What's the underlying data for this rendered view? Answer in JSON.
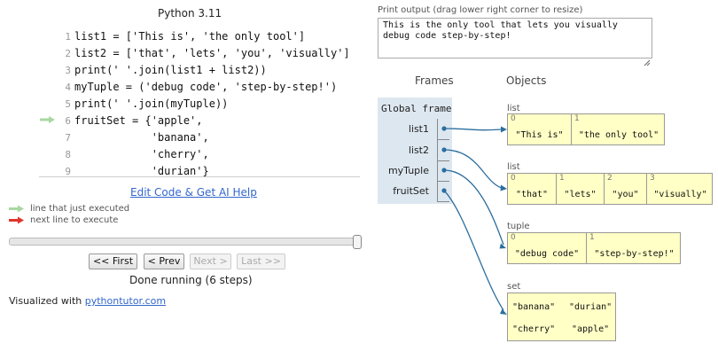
{
  "header": {
    "language": "Python 3.11"
  },
  "code": {
    "lines": [
      {
        "num": "1",
        "text": "list1 = ['This is', 'the only tool']"
      },
      {
        "num": "2",
        "text": "list2 = ['that', 'lets', 'you', 'visually']"
      },
      {
        "num": "3",
        "text": "print(' '.join(list1 + list2))"
      },
      {
        "num": "4",
        "text": "myTuple = ('debug code', 'step-by-step!')"
      },
      {
        "num": "5",
        "text": "print(' '.join(myTuple))"
      },
      {
        "num": "6",
        "text": "fruitSet = {'apple',"
      },
      {
        "num": "7",
        "text": "            'banana',"
      },
      {
        "num": "8",
        "text": "            'cherry',"
      },
      {
        "num": "9",
        "text": "            'durian'}"
      }
    ],
    "current_line": 6
  },
  "links": {
    "edit": "Edit Code & Get AI Help"
  },
  "legend": {
    "executed": "line that just executed",
    "next": "next line to execute",
    "executed_color": "#a8d8a0",
    "next_color": "#e0352b"
  },
  "nav": {
    "first": "<< First",
    "prev": "< Prev",
    "next": "Next >",
    "last": "Last >>",
    "status": "Done running (6 steps)"
  },
  "footer": {
    "prefix": "Visualized with ",
    "link": "pythontutor.com"
  },
  "output": {
    "label": "Print output (drag lower right corner to resize)",
    "text": "This is the only tool that lets you visually\ndebug code step-by-step!"
  },
  "viz": {
    "frames_header": "Frames",
    "objects_header": "Objects",
    "frame_title": "Global frame",
    "variables": [
      "list1",
      "list2",
      "myTuple",
      "fruitSet"
    ],
    "objects": [
      {
        "type": "list",
        "items": [
          {
            "index": "0",
            "value": "\"This is\""
          },
          {
            "index": "1",
            "value": "\"the only tool\""
          }
        ]
      },
      {
        "type": "list",
        "items": [
          {
            "index": "0",
            "value": "\"that\""
          },
          {
            "index": "1",
            "value": "\"lets\""
          },
          {
            "index": "2",
            "value": "\"you\""
          },
          {
            "index": "3",
            "value": "\"visually\""
          }
        ]
      },
      {
        "type": "tuple",
        "items": [
          {
            "index": "0",
            "value": "\"debug code\""
          },
          {
            "index": "1",
            "value": "\"step-by-step!\""
          }
        ]
      },
      {
        "type": "set",
        "items": [
          {
            "value": "\"banana\""
          },
          {
            "value": "\"durian\""
          },
          {
            "value": "\"cherry\""
          },
          {
            "value": "\"apple\""
          }
        ]
      }
    ],
    "heap_color": "#ffffc6",
    "frame_color": "#dde7f0",
    "pointer_color": "#2c6e9e"
  }
}
